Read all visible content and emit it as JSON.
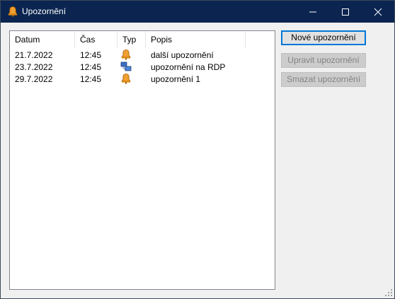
{
  "window": {
    "title": "Upozornění"
  },
  "columns": [
    "Datum",
    "Čas",
    "Typ",
    "Popis"
  ],
  "rows": [
    {
      "date": "21.7.2022",
      "time": "12:45",
      "type_icon": "bell-icon",
      "description": "další upozornění"
    },
    {
      "date": "23.7.2022",
      "time": "12:45",
      "type_icon": "rdp-icon",
      "description": "upozornění na RDP"
    },
    {
      "date": "29.7.2022",
      "time": "12:45",
      "type_icon": "bell-icon",
      "description": "upozornění 1"
    }
  ],
  "buttons": {
    "new": "Nové upozornění",
    "edit": "Upravit upozornění",
    "delete": "Smazat upozornění"
  },
  "colors": {
    "titlebar": "#0b2550",
    "accent": "#0078d7",
    "bell": "#f0a030"
  }
}
